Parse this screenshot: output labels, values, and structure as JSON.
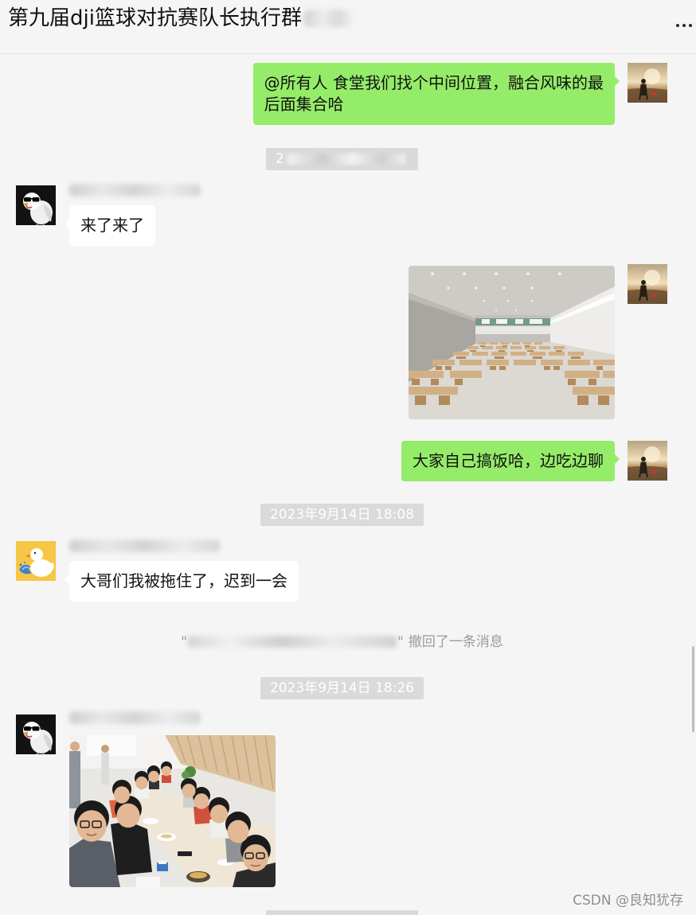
{
  "header": {
    "title": "第九届dji篮球对抗赛队长执行群"
  },
  "icons": {
    "more": "more-icon"
  },
  "colors": {
    "self_bubble": "#95ec69",
    "other_bubble": "#ffffff",
    "background": "#f5f5f5",
    "timestamp_bg": "#dadada"
  },
  "chat": {
    "self_text_1": [
      "@所有人 食堂我们找个中间位置，融合风味的最",
      "后面集合哈"
    ],
    "timestamp_1_visible": "2",
    "other_text_1": "来了来了",
    "self_text_2": "大家自己搞饭哈，边吃边聊",
    "timestamp_2": "2023年9月14日 18:08",
    "other_text_2": "大哥们我被拖住了，迟到一会",
    "recall": {
      "quote_open": "\"",
      "quote_close": "\"",
      "text": "撤回了一条消息"
    },
    "timestamp_3": "2023年9月14日 18:26"
  },
  "watermark": "CSDN @良知犹存"
}
